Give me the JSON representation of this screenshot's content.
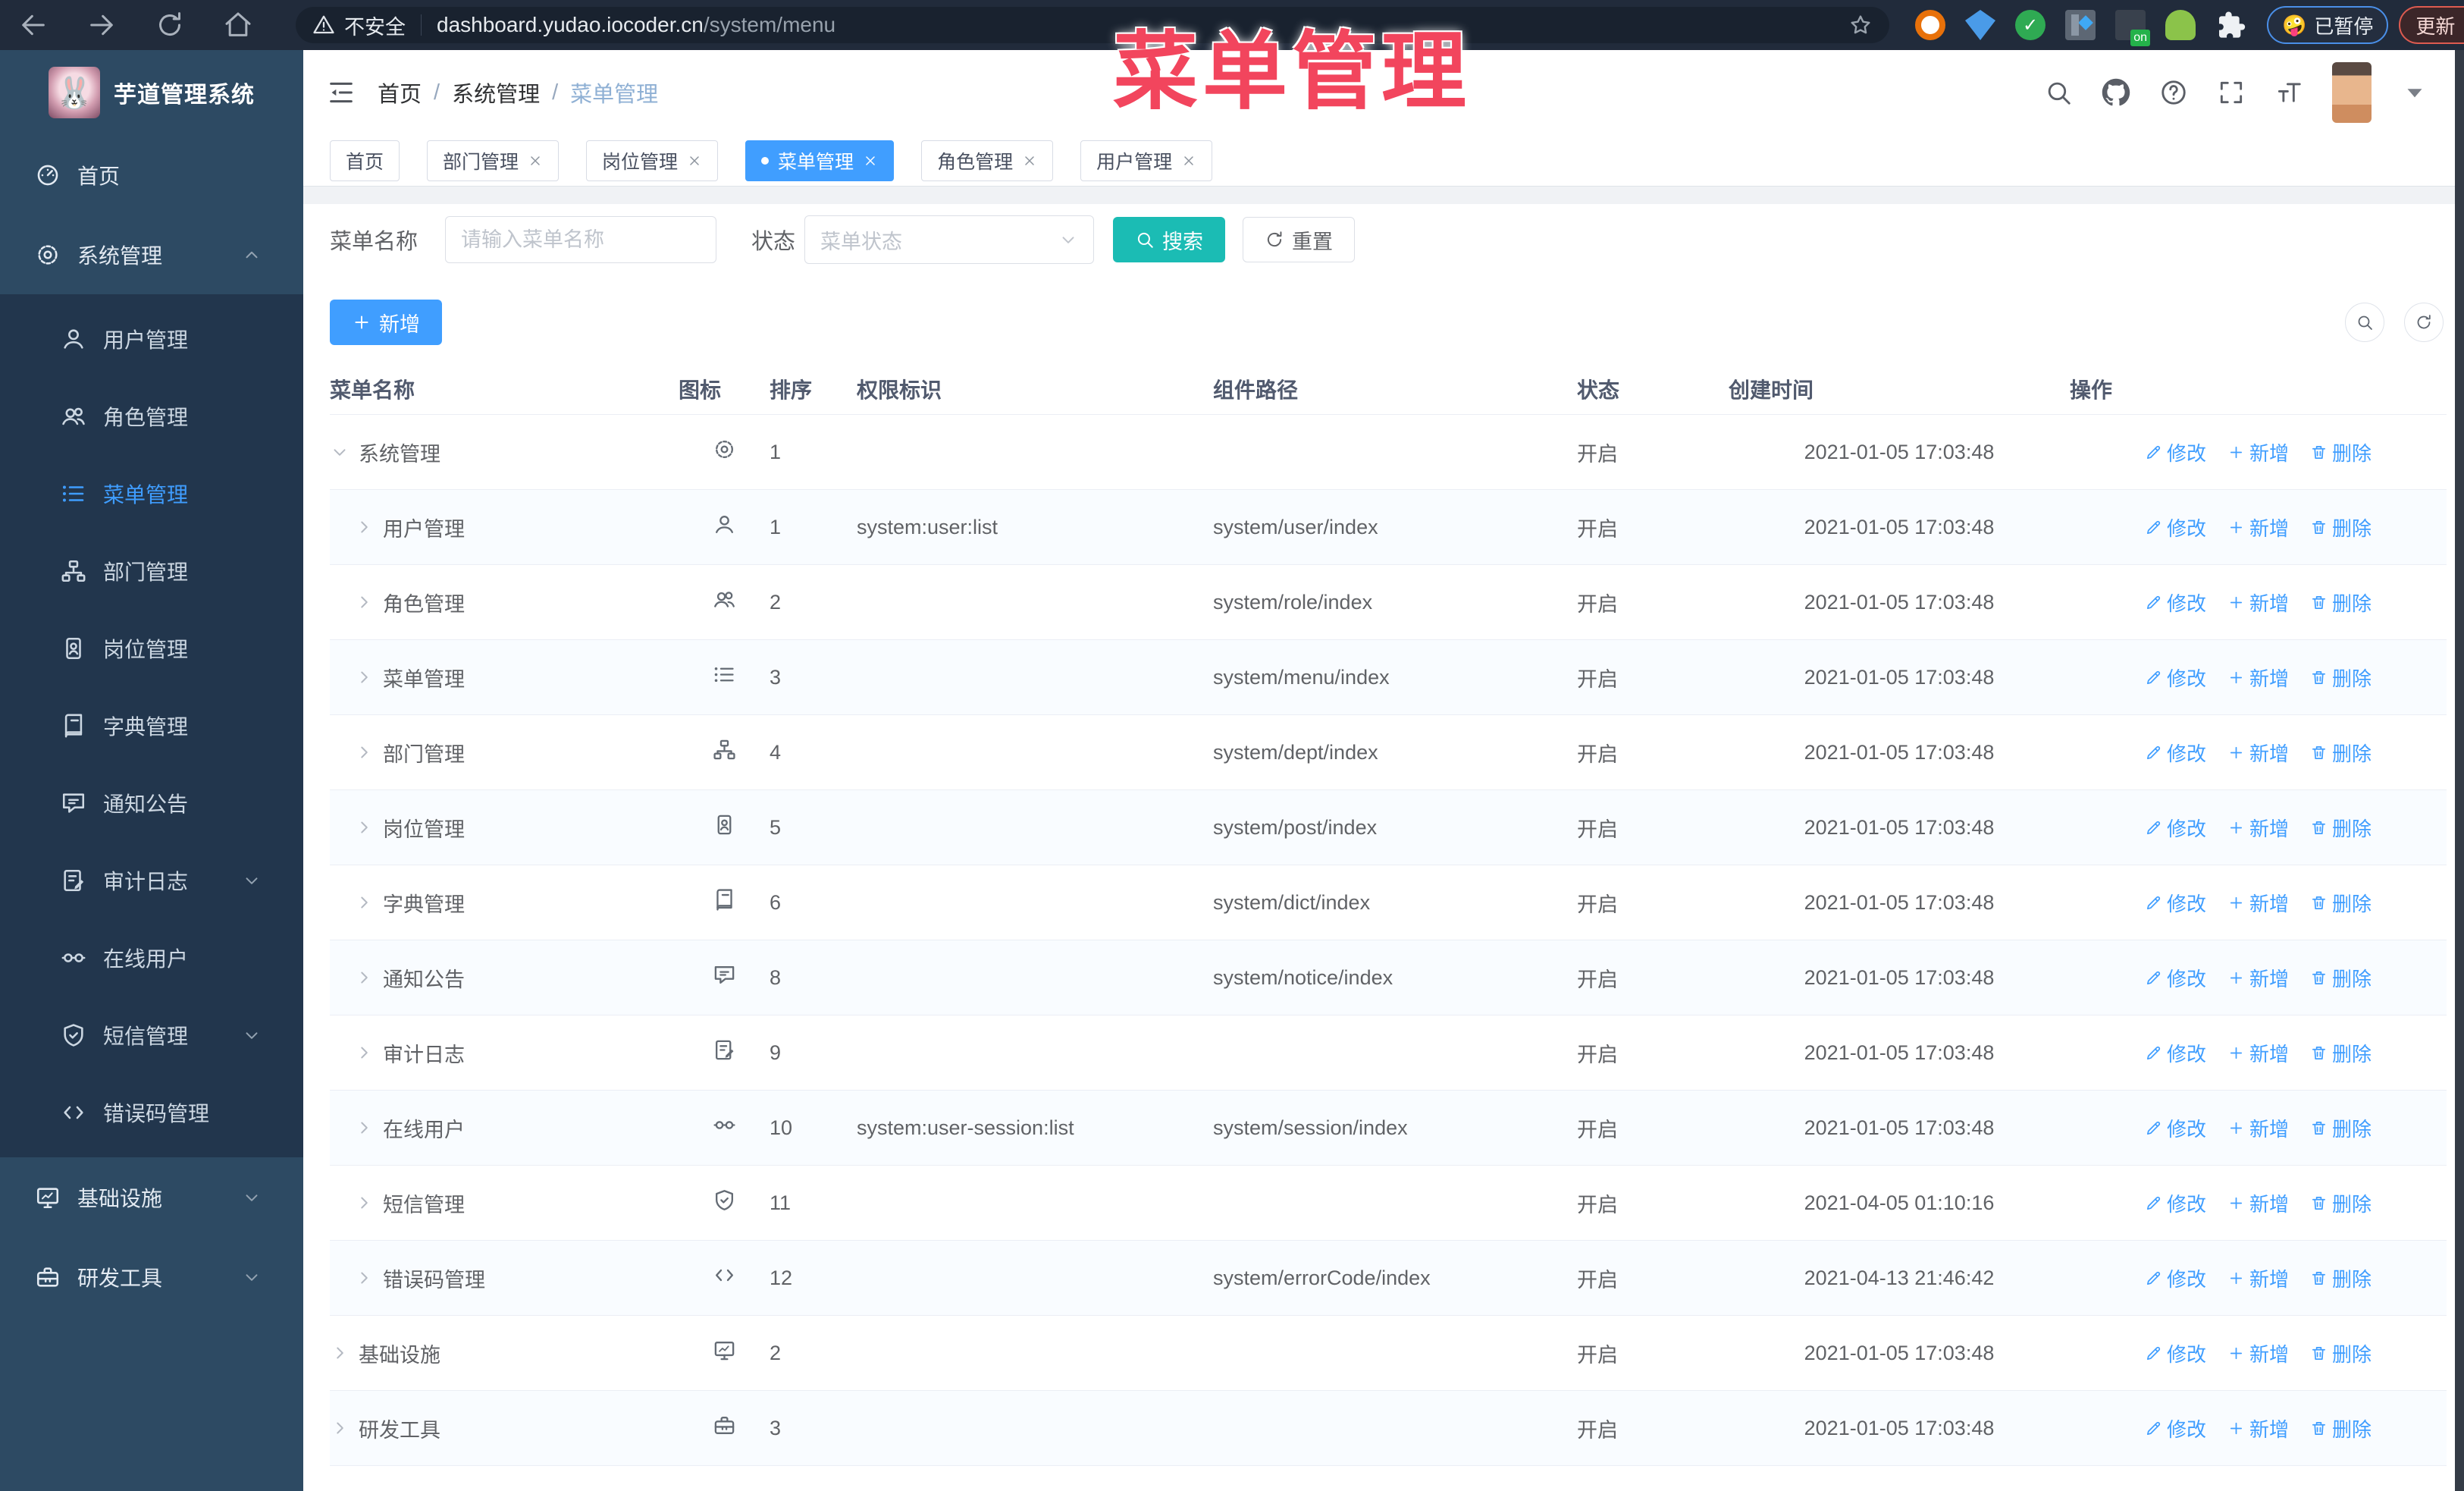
{
  "browser": {
    "security_label": "不安全",
    "url_host": "dashboard.yudao.iocoder.cn",
    "url_path": "/system/menu",
    "paused_emoji": "🤪",
    "paused_label": "已暂停",
    "update_label": "更新",
    "extensions": [
      "ext-orange-ring",
      "ext-blue-gem",
      "ext-green-check",
      "ext-columns",
      "ext-dark-on",
      "ext-green-bot",
      "ext-puzzle"
    ]
  },
  "overlay_title": "菜单管理",
  "colors": {
    "accent": "#409eff",
    "search_button": "#1bbcb4",
    "overlay_pink": "#f2455d",
    "sidebar_bg": "#2d4a63",
    "sidebar_sub_bg": "#22364d"
  },
  "sidebar": {
    "app_title": "芋道管理系统",
    "logo_emoji": "🐰",
    "items": [
      {
        "label": "首页",
        "icon": "dashboard",
        "level": "top"
      },
      {
        "label": "系统管理",
        "icon": "gear",
        "level": "top",
        "arrow": "up"
      },
      {
        "label": "用户管理",
        "icon": "user",
        "level": "sub"
      },
      {
        "label": "角色管理",
        "icon": "users",
        "level": "sub"
      },
      {
        "label": "菜单管理",
        "icon": "list",
        "level": "sub",
        "active": true
      },
      {
        "label": "部门管理",
        "icon": "tree",
        "level": "sub"
      },
      {
        "label": "岗位管理",
        "icon": "badge",
        "level": "sub"
      },
      {
        "label": "字典管理",
        "icon": "book",
        "level": "sub"
      },
      {
        "label": "通知公告",
        "icon": "chat",
        "level": "sub"
      },
      {
        "label": "审计日志",
        "icon": "log",
        "level": "sub",
        "arrow": "down"
      },
      {
        "label": "在线用户",
        "icon": "goggles",
        "level": "sub"
      },
      {
        "label": "短信管理",
        "icon": "shield",
        "level": "sub",
        "arrow": "down"
      },
      {
        "label": "错误码管理",
        "icon": "code",
        "level": "sub"
      },
      {
        "label": "基础设施",
        "icon": "monitor",
        "level": "top",
        "arrow": "down"
      },
      {
        "label": "研发工具",
        "icon": "toolbox",
        "level": "top",
        "arrow": "down"
      }
    ]
  },
  "topbar": {
    "breadcrumb": [
      "首页",
      "系统管理",
      "菜单管理"
    ]
  },
  "tabs": [
    {
      "label": "首页",
      "closable": false,
      "active": false
    },
    {
      "label": "部门管理",
      "closable": true,
      "active": false
    },
    {
      "label": "岗位管理",
      "closable": true,
      "active": false
    },
    {
      "label": "菜单管理",
      "closable": true,
      "active": true
    },
    {
      "label": "角色管理",
      "closable": true,
      "active": false
    },
    {
      "label": "用户管理",
      "closable": true,
      "active": false
    }
  ],
  "filters": {
    "name_label": "菜单名称",
    "name_placeholder": "请输入菜单名称",
    "name_value": "",
    "status_label": "状态",
    "status_placeholder": "菜单状态",
    "search_label": "搜索",
    "reset_label": "重置"
  },
  "toolbar": {
    "add_label": "新增"
  },
  "table": {
    "columns": [
      "菜单名称",
      "图标",
      "排序",
      "权限标识",
      "组件路径",
      "状态",
      "创建时间",
      "操作"
    ],
    "action_labels": [
      "修改",
      "新增",
      "删除"
    ],
    "rows": [
      {
        "name": "系统管理",
        "icon": "gear",
        "level": 0,
        "expand": "down",
        "sort": "1",
        "perm": "",
        "path": "",
        "status": "开启",
        "time": "2021-01-05 17:03:48"
      },
      {
        "name": "用户管理",
        "icon": "user",
        "level": 1,
        "expand": "right",
        "sort": "1",
        "perm": "system:user:list",
        "path": "system/user/index",
        "status": "开启",
        "time": "2021-01-05 17:03:48"
      },
      {
        "name": "角色管理",
        "icon": "users",
        "level": 1,
        "expand": "right",
        "sort": "2",
        "perm": "",
        "path": "system/role/index",
        "status": "开启",
        "time": "2021-01-05 17:03:48"
      },
      {
        "name": "菜单管理",
        "icon": "list",
        "level": 1,
        "expand": "right",
        "sort": "3",
        "perm": "",
        "path": "system/menu/index",
        "status": "开启",
        "time": "2021-01-05 17:03:48"
      },
      {
        "name": "部门管理",
        "icon": "tree",
        "level": 1,
        "expand": "right",
        "sort": "4",
        "perm": "",
        "path": "system/dept/index",
        "status": "开启",
        "time": "2021-01-05 17:03:48"
      },
      {
        "name": "岗位管理",
        "icon": "badge",
        "level": 1,
        "expand": "right",
        "sort": "5",
        "perm": "",
        "path": "system/post/index",
        "status": "开启",
        "time": "2021-01-05 17:03:48"
      },
      {
        "name": "字典管理",
        "icon": "book",
        "level": 1,
        "expand": "right",
        "sort": "6",
        "perm": "",
        "path": "system/dict/index",
        "status": "开启",
        "time": "2021-01-05 17:03:48"
      },
      {
        "name": "通知公告",
        "icon": "chat",
        "level": 1,
        "expand": "right",
        "sort": "8",
        "perm": "",
        "path": "system/notice/index",
        "status": "开启",
        "time": "2021-01-05 17:03:48"
      },
      {
        "name": "审计日志",
        "icon": "log",
        "level": 1,
        "expand": "right",
        "sort": "9",
        "perm": "",
        "path": "",
        "status": "开启",
        "time": "2021-01-05 17:03:48"
      },
      {
        "name": "在线用户",
        "icon": "goggles",
        "level": 1,
        "expand": "right",
        "sort": "10",
        "perm": "system:user-session:list",
        "path": "system/session/index",
        "status": "开启",
        "time": "2021-01-05 17:03:48"
      },
      {
        "name": "短信管理",
        "icon": "shield",
        "level": 1,
        "expand": "right",
        "sort": "11",
        "perm": "",
        "path": "",
        "status": "开启",
        "time": "2021-04-05 01:10:16"
      },
      {
        "name": "错误码管理",
        "icon": "code",
        "level": 1,
        "expand": "right",
        "sort": "12",
        "perm": "",
        "path": "system/errorCode/index",
        "status": "开启",
        "time": "2021-04-13 21:46:42"
      },
      {
        "name": "基础设施",
        "icon": "monitor",
        "level": 0,
        "expand": "right",
        "sort": "2",
        "perm": "",
        "path": "",
        "status": "开启",
        "time": "2021-01-05 17:03:48"
      },
      {
        "name": "研发工具",
        "icon": "toolbox",
        "level": 0,
        "expand": "right",
        "sort": "3",
        "perm": "",
        "path": "",
        "status": "开启",
        "time": "2021-01-05 17:03:48"
      }
    ]
  }
}
